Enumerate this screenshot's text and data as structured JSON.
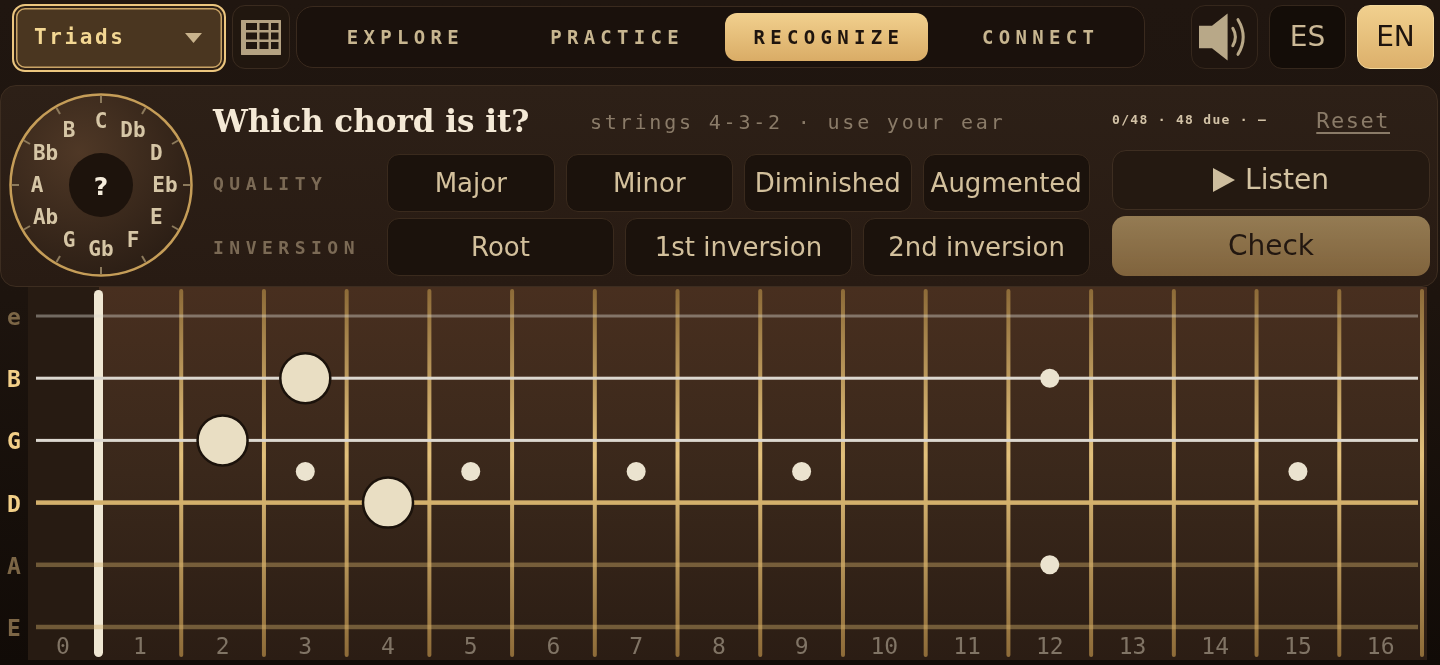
{
  "mode_select": {
    "value": "Triads"
  },
  "tabs": [
    {
      "label": "EXPLORE",
      "selected": false
    },
    {
      "label": "PRACTICE",
      "selected": false
    },
    {
      "label": "RECOGNIZE",
      "selected": true
    },
    {
      "label": "CONNECT",
      "selected": false
    }
  ],
  "languages": [
    {
      "label": "ES",
      "selected": false
    },
    {
      "label": "EN",
      "selected": true
    }
  ],
  "quiz": {
    "title": "Which chord is it?",
    "hint": "strings 4-3-2 · use your ear",
    "progress": "0/48 · 48 due · –",
    "reset": "Reset",
    "note_wheel": {
      "center": "?",
      "right_side": [
        "C",
        "Db",
        "D",
        "Eb",
        "E",
        "F",
        "Gb"
      ],
      "left_side": [
        "B",
        "Bb",
        "A",
        "Ab",
        "G"
      ]
    },
    "quality": {
      "label": "QUALITY",
      "options": [
        {
          "label": "Major",
          "selected": false
        },
        {
          "label": "Minor",
          "selected": false
        },
        {
          "label": "Diminished",
          "selected": false
        },
        {
          "label": "Augmented",
          "selected": false
        }
      ]
    },
    "inversion": {
      "label": "INVERSION",
      "options": [
        {
          "label": "Root",
          "selected": false
        },
        {
          "label": "1st inversion",
          "selected": false
        },
        {
          "label": "2nd inversion",
          "selected": false
        }
      ]
    },
    "listen": {
      "label": "Listen"
    },
    "check": {
      "label": "Check",
      "disabled": true
    }
  },
  "fretboard": {
    "strings": [
      {
        "label": "e",
        "kind": "plain",
        "active": false,
        "pressed": [
          false,
          false,
          false,
          false,
          false,
          false,
          false,
          false,
          false,
          false,
          false,
          false,
          false,
          false,
          false,
          false,
          false
        ]
      },
      {
        "label": "B",
        "kind": "plain",
        "active": true,
        "pressed": [
          false,
          false,
          false,
          true,
          false,
          false,
          false,
          false,
          false,
          false,
          false,
          false,
          false,
          false,
          false,
          false,
          false
        ]
      },
      {
        "label": "G",
        "kind": "plain",
        "active": true,
        "pressed": [
          false,
          false,
          true,
          false,
          false,
          false,
          false,
          false,
          false,
          false,
          false,
          false,
          false,
          false,
          false,
          false,
          false
        ]
      },
      {
        "label": "D",
        "kind": "wound",
        "active": true,
        "pressed": [
          false,
          false,
          false,
          false,
          true,
          false,
          false,
          false,
          false,
          false,
          false,
          false,
          false,
          false,
          false,
          false,
          false
        ]
      },
      {
        "label": "A",
        "kind": "wound",
        "active": false,
        "pressed": [
          false,
          false,
          false,
          false,
          false,
          false,
          false,
          false,
          false,
          false,
          false,
          false,
          false,
          false,
          false,
          false,
          false
        ]
      },
      {
        "label": "E",
        "kind": "wound",
        "active": false,
        "pressed": [
          false,
          false,
          false,
          false,
          false,
          false,
          false,
          false,
          false,
          false,
          false,
          false,
          false,
          false,
          false,
          false,
          false
        ]
      }
    ],
    "frets": [
      {
        "label": "0",
        "kind": "plain"
      },
      {
        "label": "1",
        "kind": "plain"
      },
      {
        "label": "2",
        "kind": "plain"
      },
      {
        "label": "3",
        "kind": "dot"
      },
      {
        "label": "4",
        "kind": "plain"
      },
      {
        "label": "5",
        "kind": "dot"
      },
      {
        "label": "6",
        "kind": "plain"
      },
      {
        "label": "7",
        "kind": "dot"
      },
      {
        "label": "8",
        "kind": "plain"
      },
      {
        "label": "9",
        "kind": "dot"
      },
      {
        "label": "10",
        "kind": "plain"
      },
      {
        "label": "11",
        "kind": "plain"
      },
      {
        "label": "12",
        "kind": "double"
      },
      {
        "label": "13",
        "kind": "plain"
      },
      {
        "label": "14",
        "kind": "plain"
      },
      {
        "label": "15",
        "kind": "dot"
      },
      {
        "label": "16",
        "kind": "plain"
      }
    ]
  }
}
